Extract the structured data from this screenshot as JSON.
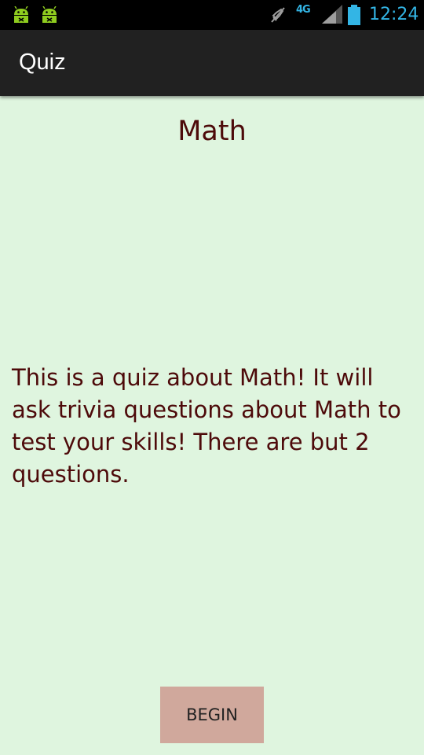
{
  "status_bar": {
    "network_type": "4G",
    "time": "12:24",
    "icons": [
      "android-debug-icon",
      "android-debug-icon",
      "mute-icon",
      "signal-icon",
      "battery-icon"
    ],
    "accent_color": "#33b5e5"
  },
  "action_bar": {
    "title": "Quiz",
    "background_color": "#212121"
  },
  "quiz": {
    "title": "Math",
    "description": "This is a quiz about Math!  It will ask trivia questions about Math to test your skills! There are but 2 questions.",
    "text_color": "#4d0a0a",
    "background_color": "#dff5df"
  },
  "begin_button": {
    "label": "BEGIN",
    "background_color": "#d0a89c"
  }
}
